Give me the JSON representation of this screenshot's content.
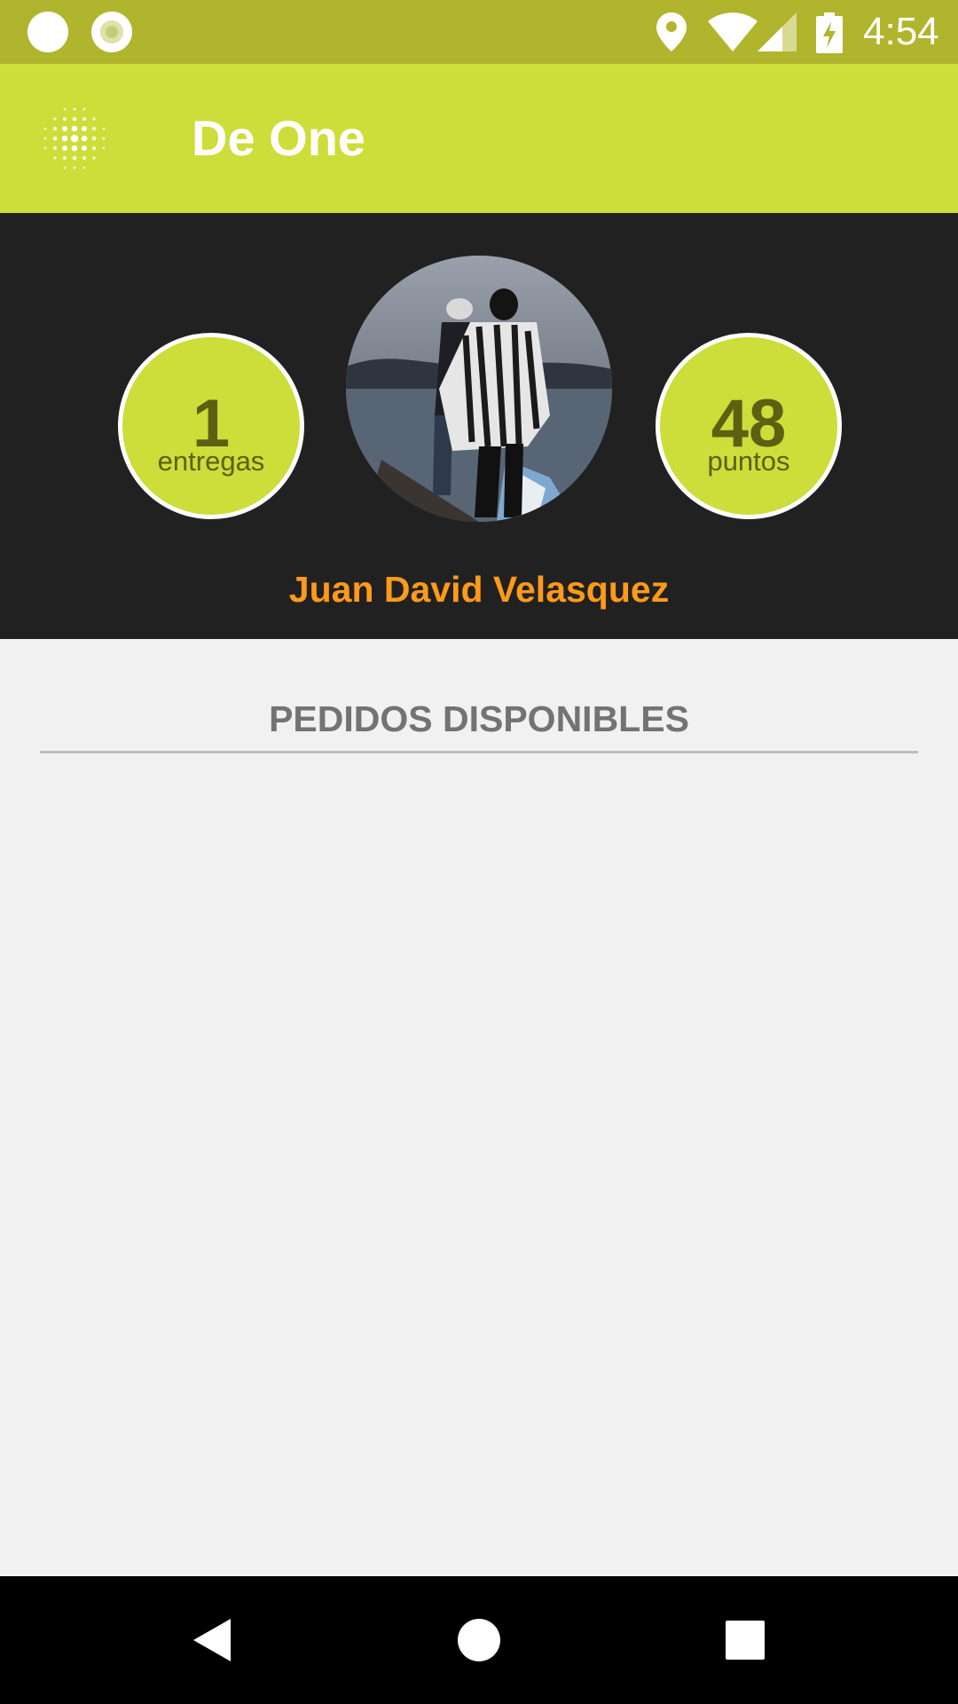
{
  "status_bar": {
    "time": "4:54",
    "icons": [
      "notification-dot-icon",
      "notification-ring-icon",
      "location-icon",
      "wifi-icon",
      "cellular-signal-icon",
      "battery-charging-icon"
    ]
  },
  "app_bar": {
    "title": "De One",
    "menu_icon": "dots-logo-menu-icon"
  },
  "profile": {
    "deliveries": {
      "value": "1",
      "label": "entregas"
    },
    "points": {
      "value": "48",
      "label": "puntos"
    },
    "name": "Juan David Velasquez",
    "avatar": "profile-photo"
  },
  "orders": {
    "section_title": "PEDIDOS DISPONIBLES",
    "items": []
  },
  "nav_bar": {
    "buttons": [
      "back-icon",
      "home-icon",
      "recents-icon"
    ]
  },
  "colors": {
    "status_bar": "#b0b52d",
    "app_bar": "#cddd3a",
    "header_bg": "#212121",
    "stat_circle": "#cddd3a",
    "stat_text": "#5c6011",
    "user_name": "#ff9a1a",
    "section_title": "#737373",
    "background": "#f1f1f1"
  }
}
